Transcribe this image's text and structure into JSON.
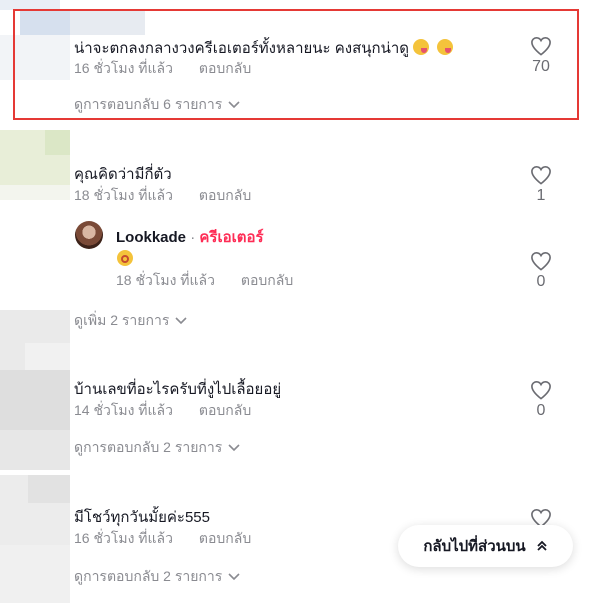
{
  "comments": [
    {
      "text": "น่าจะตกลงกลางวงครีเอเตอร์ทั้งหลายนะ คงสนุกน่าดู",
      "time": "16 ชั่วโมง ที่แล้ว",
      "reply_label": "ตอบกลับ",
      "likes": "70",
      "more_label": "ดูการตอบกลับ 6 รายการ",
      "emojis": [
        "laughing-sweat-emoji",
        "laughing-sweat-emoji"
      ]
    },
    {
      "text": "คุณคิดว่ามีกี่ตัว",
      "time": "18 ชั่วโมง ที่แล้ว",
      "reply_label": "ตอบกลับ",
      "likes": "1",
      "more_label": "ดูเพิ่ม 2 รายการ",
      "reply": {
        "username": "Lookkade",
        "separator": " · ",
        "badge": "ครีเอเตอร์",
        "emoji": "dizzy-face-emoji",
        "time": "18 ชั่วโมง ที่แล้ว",
        "reply_label": "ตอบกลับ",
        "likes": "0"
      }
    },
    {
      "text": "บ้านเลขที่อะไรครับที่งูไปเลื้อยอยู่",
      "time": "14 ชั่วโมง ที่แล้ว",
      "reply_label": "ตอบกลับ",
      "likes": "0",
      "more_label": "ดูการตอบกลับ 2 รายการ"
    },
    {
      "text": "มีโชว์ทุกวันมั้ยค่ะ555",
      "time": "16 ชั่วโมง ที่แล้ว",
      "reply_label": "ตอบกลับ",
      "likes": "",
      "more_label": "ดูการตอบกลับ 2 รายการ"
    }
  ],
  "back_to_top": {
    "label": "กลับไปที่ส่วนบน",
    "icon": "double-chevron-up-icon"
  },
  "colors": {
    "highlight_border": "#e53935",
    "creator_badge": "#fe2c55",
    "meta_text": "#8a8b91"
  }
}
